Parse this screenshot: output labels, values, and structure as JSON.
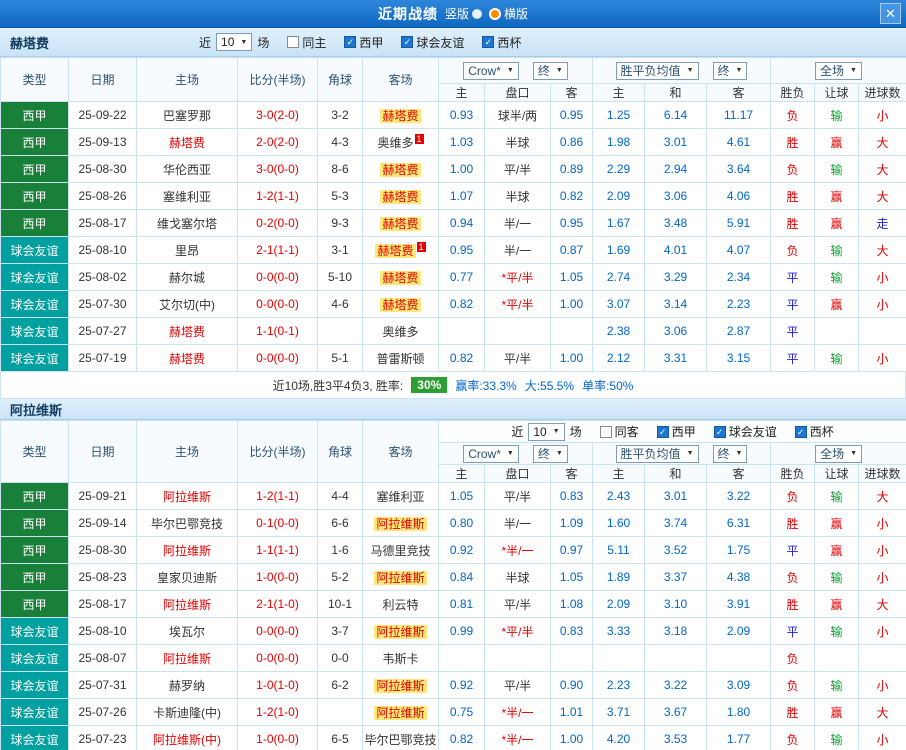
{
  "topbar": {
    "title": "近期战绩",
    "vertical_label": "竖版",
    "horizontal_label": "横版",
    "close": "✕"
  },
  "colors": {
    "league_bg": "#188038",
    "friendly_bg": "#00a0a0",
    "score": "#e60000",
    "odds": "#0066cc",
    "focal_team": "#e60000",
    "focal_highlight_bg": "#ffe87a",
    "result": {
      "胜": "#e60000",
      "平": "#1c1cd8",
      "负": "#e60000",
      "赢": "#e60000",
      "输": "#089f2f",
      "走": "#1c1cd8",
      "大": "#e60000",
      "小": "#e60000"
    }
  },
  "sections": [
    {
      "team": "赫塔费",
      "filters": {
        "near": "近",
        "count": "10",
        "unit": "场",
        "options": [
          {
            "label": "同主",
            "checked": false
          },
          {
            "label": "西甲",
            "checked": true
          },
          {
            "label": "球会友谊",
            "checked": true
          },
          {
            "label": "西杯",
            "checked": true
          }
        ]
      },
      "table": {
        "columns": [
          "类型",
          "日期",
          "主场",
          "比分(半场)",
          "角球",
          "客场"
        ],
        "sub_columns": [
          "主",
          "盘口",
          "客",
          "主",
          "和",
          "客",
          "胜负",
          "让球",
          "进球数"
        ],
        "dropdowns": {
          "bookmaker": "Crow*",
          "final_a": "终",
          "europe": "胜平负均值",
          "final_b": "终",
          "scope": "全场"
        }
      },
      "rows": [
        {
          "type": "西甲",
          "date": "25-09-22",
          "home": "巴塞罗那",
          "score": "3-0(2-0)",
          "corner": "3-2",
          "away": "赫塔费",
          "away_focal": true,
          "odds_asian": [
            "0.93",
            "球半/两",
            "0.95"
          ],
          "odds_europe": [
            "1.25",
            "6.14",
            "11.17"
          ],
          "result": "负",
          "handicap_result": "输",
          "goals": "小"
        },
        {
          "type": "西甲",
          "date": "25-09-13",
          "home": "赫塔费",
          "home_focal": true,
          "score": "2-0(2-0)",
          "corner": "4-3",
          "away": "奥维多",
          "away_badge": "1",
          "odds_asian": [
            "1.03",
            "半球",
            "0.86"
          ],
          "odds_europe": [
            "1.98",
            "3.01",
            "4.61"
          ],
          "result": "胜",
          "handicap_result": "赢",
          "goals": "大"
        },
        {
          "type": "西甲",
          "date": "25-08-30",
          "home": "华伦西亚",
          "score": "3-0(0-0)",
          "corner": "8-6",
          "away": "赫塔费",
          "away_focal": true,
          "odds_asian": [
            "1.00",
            "平/半",
            "0.89"
          ],
          "odds_europe": [
            "2.29",
            "2.94",
            "3.64"
          ],
          "result": "负",
          "handicap_result": "输",
          "goals": "大"
        },
        {
          "type": "西甲",
          "date": "25-08-26",
          "home": "塞维利亚",
          "score": "1-2(1-1)",
          "corner": "5-3",
          "away": "赫塔费",
          "away_focal": true,
          "odds_asian": [
            "1.07",
            "半球",
            "0.82"
          ],
          "odds_europe": [
            "2.09",
            "3.06",
            "4.06"
          ],
          "result": "胜",
          "handicap_result": "赢",
          "goals": "大"
        },
        {
          "type": "西甲",
          "date": "25-08-17",
          "home": "维戈塞尔塔",
          "score": "0-2(0-0)",
          "corner": "9-3",
          "away": "赫塔费",
          "away_focal": true,
          "odds_asian": [
            "0.94",
            "半/一",
            "0.95"
          ],
          "odds_europe": [
            "1.67",
            "3.48",
            "5.91"
          ],
          "result": "胜",
          "handicap_result": "赢",
          "goals": "走"
        },
        {
          "type": "球会友谊",
          "date": "25-08-10",
          "home": "里昂",
          "score": "2-1(1-1)",
          "corner": "3-1",
          "away": "赫塔费",
          "away_focal": true,
          "away_badge": "1",
          "odds_asian": [
            "0.95",
            "半/一",
            "0.87"
          ],
          "odds_europe": [
            "1.69",
            "4.01",
            "4.07"
          ],
          "result": "负",
          "handicap_result": "输",
          "goals": "大"
        },
        {
          "type": "球会友谊",
          "date": "25-08-02",
          "home": "赫尔城",
          "score": "0-0(0-0)",
          "corner": "5-10",
          "away": "赫塔费",
          "away_focal": true,
          "odds_asian": [
            "0.77",
            "*平/半",
            "1.05"
          ],
          "odds_europe": [
            "2.74",
            "3.29",
            "2.34"
          ],
          "result": "平",
          "handicap_result": "输",
          "goals": "小"
        },
        {
          "type": "球会友谊",
          "date": "25-07-30",
          "home": "艾尔切(中)",
          "score": "0-0(0-0)",
          "corner": "4-6",
          "away": "赫塔费",
          "away_focal": true,
          "odds_asian": [
            "0.82",
            "*平/半",
            "1.00"
          ],
          "odds_europe": [
            "3.07",
            "3.14",
            "2.23"
          ],
          "result": "平",
          "handicap_result": "赢",
          "goals": "小"
        },
        {
          "type": "球会友谊",
          "date": "25-07-27",
          "home": "赫塔费",
          "home_focal": true,
          "score": "1-1(0-1)",
          "corner": "",
          "away": "奥维多",
          "odds_asian": [
            "",
            "",
            ""
          ],
          "odds_europe": [
            "2.38",
            "3.06",
            "2.87"
          ],
          "result": "平",
          "handicap_result": "",
          "goals": ""
        },
        {
          "type": "球会友谊",
          "date": "25-07-19",
          "home": "赫塔费",
          "home_focal": true,
          "score": "0-0(0-0)",
          "corner": "5-1",
          "away": "普雷斯顿",
          "odds_asian": [
            "0.82",
            "平/半",
            "1.00"
          ],
          "odds_europe": [
            "2.12",
            "3.31",
            "3.15"
          ],
          "result": "平",
          "handicap_result": "输",
          "goals": "小"
        }
      ],
      "summary": {
        "prefix": "近10场,胜3平4负3, 胜率:",
        "rate": "30%",
        "stats": [
          "赢率:33.3%",
          "大:55.5%",
          "单率:50%"
        ]
      }
    },
    {
      "team": "阿拉维斯",
      "filters": {
        "near": "近",
        "count": "10",
        "unit": "场",
        "options": [
          {
            "label": "同客",
            "checked": false
          },
          {
            "label": "西甲",
            "checked": true
          },
          {
            "label": "球会友谊",
            "checked": true
          },
          {
            "label": "西杯",
            "checked": true
          }
        ]
      },
      "table": {
        "columns": [
          "类型",
          "日期",
          "主场",
          "比分(半场)",
          "角球",
          "客场"
        ],
        "sub_columns": [
          "主",
          "盘口",
          "客",
          "主",
          "和",
          "客",
          "胜负",
          "让球",
          "进球数"
        ],
        "dropdowns": {
          "bookmaker": "Crow*",
          "final_a": "终",
          "europe": "胜平负均值",
          "final_b": "终",
          "scope": "全场"
        }
      },
      "rows": [
        {
          "type": "西甲",
          "date": "25-09-21",
          "home": "阿拉维斯",
          "home_focal": true,
          "score": "1-2(1-1)",
          "corner": "4-4",
          "away": "塞维利亚",
          "odds_asian": [
            "1.05",
            "平/半",
            "0.83"
          ],
          "odds_europe": [
            "2.43",
            "3.01",
            "3.22"
          ],
          "result": "负",
          "handicap_result": "输",
          "goals": "大"
        },
        {
          "type": "西甲",
          "date": "25-09-14",
          "home": "毕尔巴鄂竞技",
          "score": "0-1(0-0)",
          "corner": "6-6",
          "away": "阿拉维斯",
          "away_focal": true,
          "odds_asian": [
            "0.80",
            "半/一",
            "1.09"
          ],
          "odds_europe": [
            "1.60",
            "3.74",
            "6.31"
          ],
          "result": "胜",
          "handicap_result": "赢",
          "goals": "小"
        },
        {
          "type": "西甲",
          "date": "25-08-30",
          "home": "阿拉维斯",
          "home_focal": true,
          "score": "1-1(1-1)",
          "corner": "1-6",
          "away": "马德里竞技",
          "odds_asian": [
            "0.92",
            "*半/一",
            "0.97"
          ],
          "odds_europe": [
            "5.11",
            "3.52",
            "1.75"
          ],
          "result": "平",
          "handicap_result": "赢",
          "goals": "小"
        },
        {
          "type": "西甲",
          "date": "25-08-23",
          "home": "皇家贝迪斯",
          "score": "1-0(0-0)",
          "corner": "5-2",
          "away": "阿拉维斯",
          "away_focal": true,
          "odds_asian": [
            "0.84",
            "半球",
            "1.05"
          ],
          "odds_europe": [
            "1.89",
            "3.37",
            "4.38"
          ],
          "result": "负",
          "handicap_result": "输",
          "goals": "小"
        },
        {
          "type": "西甲",
          "date": "25-08-17",
          "home": "阿拉维斯",
          "home_focal": true,
          "score": "2-1(1-0)",
          "corner": "10-1",
          "away": "利云特",
          "odds_asian": [
            "0.81",
            "平/半",
            "1.08"
          ],
          "odds_europe": [
            "2.09",
            "3.10",
            "3.91"
          ],
          "result": "胜",
          "handicap_result": "赢",
          "goals": "大"
        },
        {
          "type": "球会友谊",
          "date": "25-08-10",
          "home": "埃瓦尔",
          "score": "0-0(0-0)",
          "corner": "3-7",
          "away": "阿拉维斯",
          "away_focal": true,
          "odds_asian": [
            "0.99",
            "*平/半",
            "0.83"
          ],
          "odds_europe": [
            "3.33",
            "3.18",
            "2.09"
          ],
          "result": "平",
          "handicap_result": "输",
          "goals": "小"
        },
        {
          "type": "球会友谊",
          "date": "25-08-07",
          "home": "阿拉维斯",
          "home_focal": true,
          "score": "0-0(0-0)",
          "corner": "0-0",
          "away": "韦斯卡",
          "odds_asian": [
            "",
            "",
            ""
          ],
          "odds_europe": [
            "",
            "",
            ""
          ],
          "result": "负",
          "handicap_result": "",
          "goals": ""
        },
        {
          "type": "球会友谊",
          "date": "25-07-31",
          "home": "赫罗纳",
          "score": "1-0(1-0)",
          "corner": "6-2",
          "away": "阿拉维斯",
          "away_focal": true,
          "odds_asian": [
            "0.92",
            "平/半",
            "0.90"
          ],
          "odds_europe": [
            "2.23",
            "3.22",
            "3.09"
          ],
          "result": "负",
          "handicap_result": "输",
          "goals": "小"
        },
        {
          "type": "球会友谊",
          "date": "25-07-26",
          "home": "卡斯迪隆(中)",
          "score": "1-2(1-0)",
          "corner": "",
          "away": "阿拉维斯",
          "away_focal": true,
          "odds_asian": [
            "0.75",
            "*半/一",
            "1.01"
          ],
          "odds_europe": [
            "3.71",
            "3.67",
            "1.80"
          ],
          "result": "胜",
          "handicap_result": "赢",
          "goals": "大"
        },
        {
          "type": "球会友谊",
          "date": "25-07-23",
          "home": "阿拉维斯(中)",
          "home_focal": true,
          "score": "1-0(0-0)",
          "corner": "6-5",
          "away": "毕尔巴鄂竞技",
          "odds_asian": [
            "0.82",
            "*半/一",
            "1.00"
          ],
          "odds_europe": [
            "4.20",
            "3.53",
            "1.77"
          ],
          "result": "负",
          "handicap_result": "输",
          "goals": "小"
        }
      ]
    }
  ]
}
